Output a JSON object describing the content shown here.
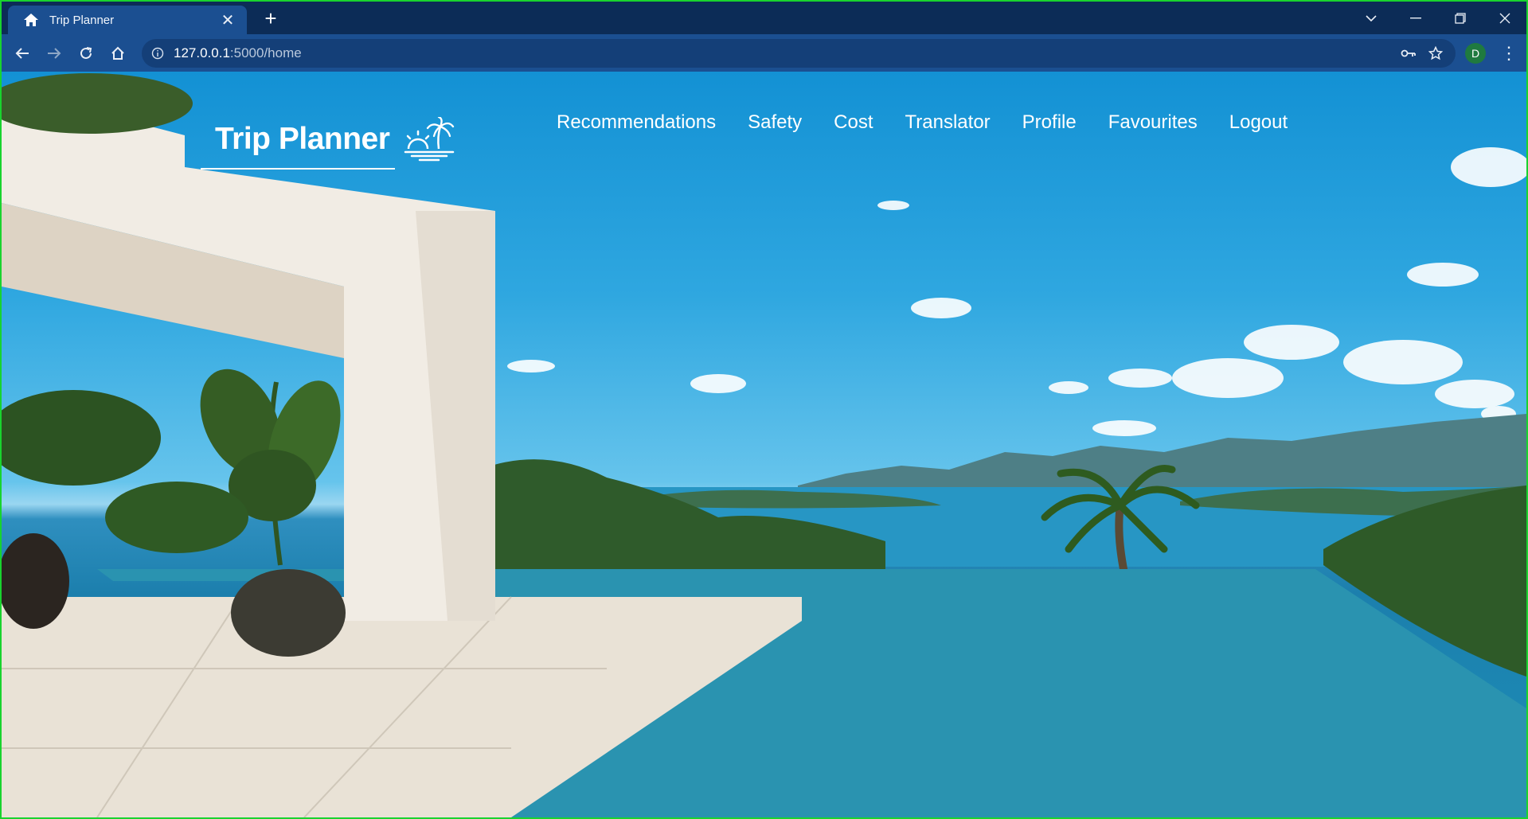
{
  "browser": {
    "tab": {
      "title": "Trip Planner",
      "favicon": "house-icon"
    },
    "url": {
      "host": "127.0.0.1",
      "path": ":5000/home"
    },
    "profile_initial": "D",
    "colors": {
      "frame_border": "#19d32e",
      "tabbar": "#0c2c57",
      "toolbar": "#1b4f91",
      "avatar": "#1f7a3f"
    }
  },
  "page": {
    "brand": {
      "title": "Trip Planner",
      "logo": "beach-sunset-icon"
    },
    "nav": [
      {
        "label": "Recommendations"
      },
      {
        "label": "Safety"
      },
      {
        "label": "Cost"
      },
      {
        "label": "Translator"
      },
      {
        "label": "Profile"
      },
      {
        "label": "Favourites"
      },
      {
        "label": "Logout"
      }
    ],
    "background": "infinity-pool-sea-view-photo"
  }
}
